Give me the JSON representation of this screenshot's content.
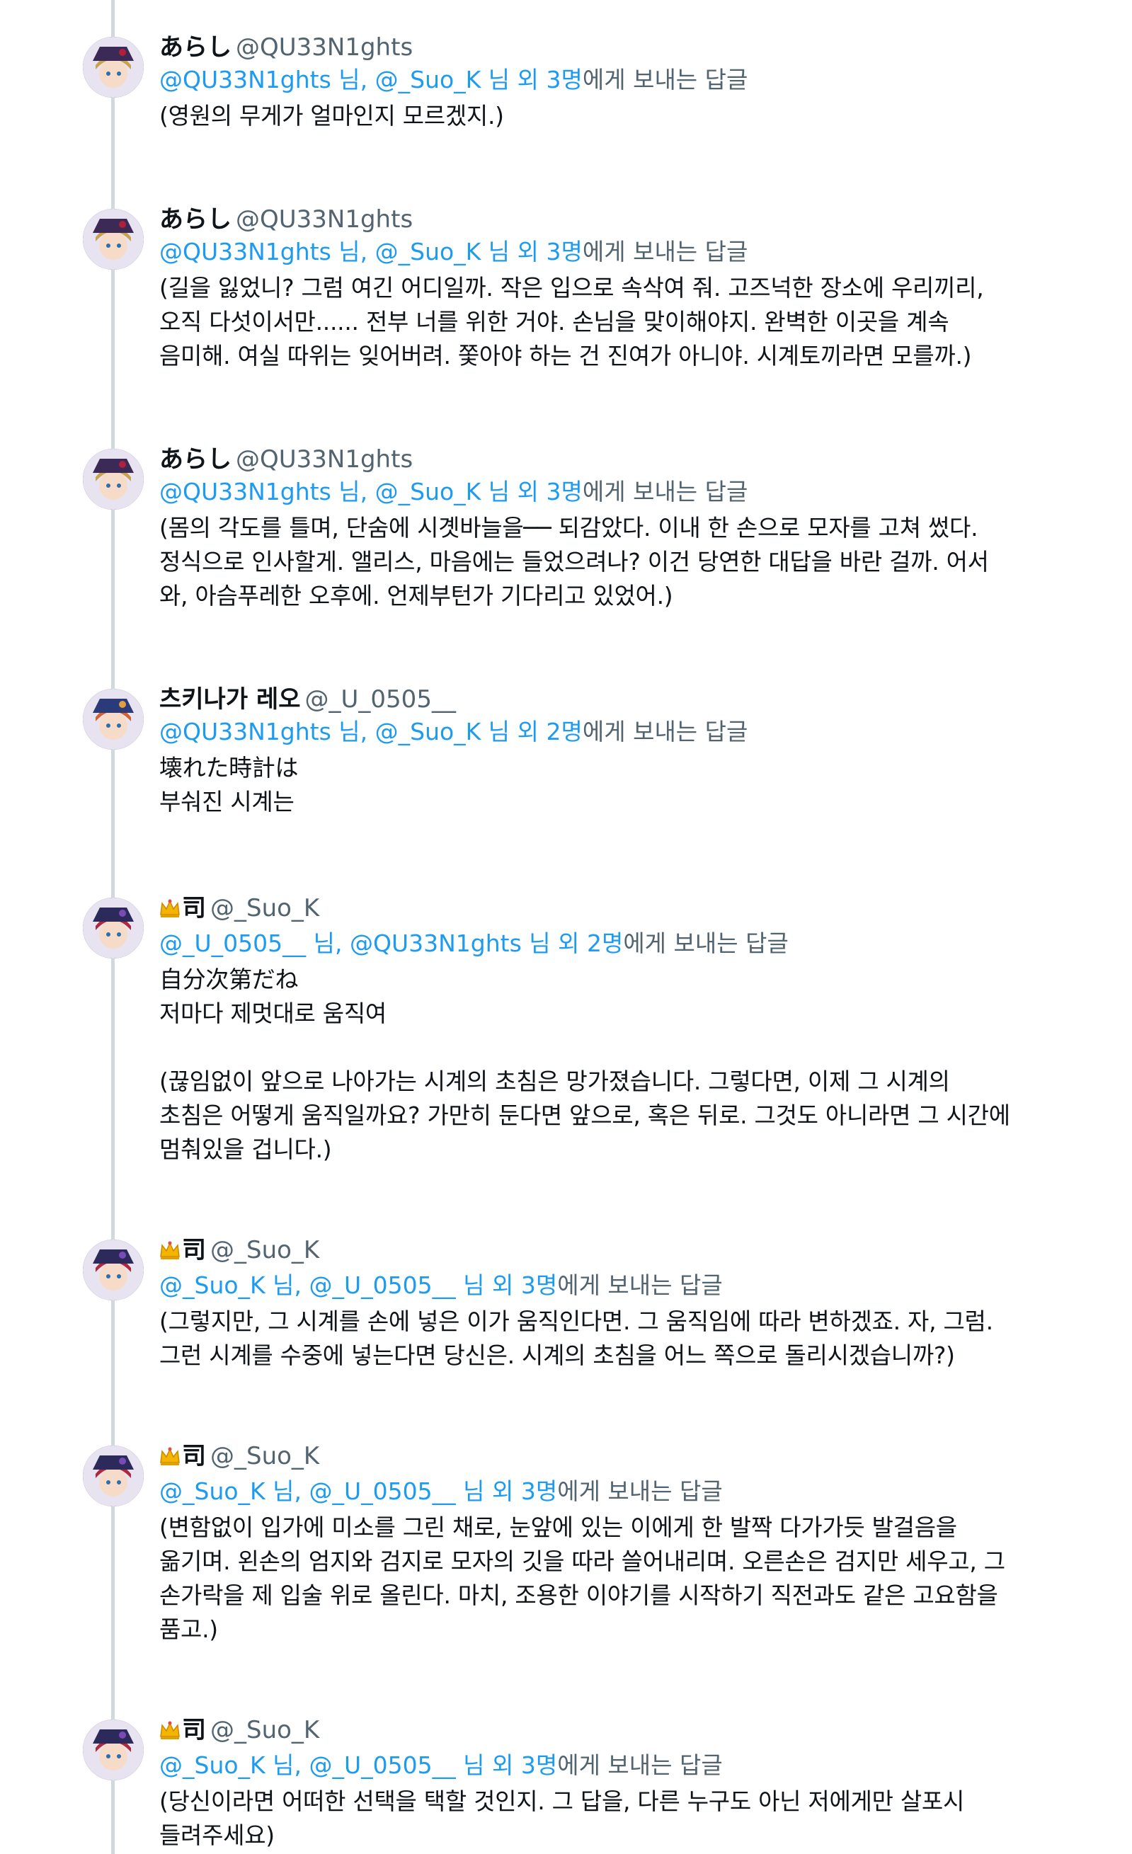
{
  "thread": {
    "tweets": [
      {
        "display_name": "あらし",
        "handle": "@QU33N1ghts",
        "has_crown": false,
        "avatar": {
          "hair": "#c9a24a",
          "hat": "#3a2a55",
          "accent": "#b0203a"
        },
        "reply_mentions": "@QU33N1ghts 님, @_Suo_K 님 외 3명",
        "reply_suffix": "에게 보내는 답글",
        "text": "(영원의 무게가 얼마인지 모르겠지.)"
      },
      {
        "display_name": "あらし",
        "handle": "@QU33N1ghts",
        "has_crown": false,
        "avatar": {
          "hair": "#c9a24a",
          "hat": "#3a2a55",
          "accent": "#b0203a"
        },
        "reply_mentions": "@QU33N1ghts 님, @_Suo_K 님 외 3명",
        "reply_suffix": "에게 보내는 답글",
        "text": "(길을 잃었니? 그럼 여긴 어디일까. 작은 입으로 속삭여 줘. 고즈넉한 장소에 우리끼리,\n오직 다섯이서만...... 전부 너를 위한 거야. 손님을 맞이해야지. 완벽한 이곳을 계속\n음미해. 여실 따위는 잊어버려. 쫓아야 하는 건 진여가 아니야. 시계토끼라면 모를까.)"
      },
      {
        "display_name": "あらし",
        "handle": "@QU33N1ghts",
        "has_crown": false,
        "avatar": {
          "hair": "#c9a24a",
          "hat": "#3a2a55",
          "accent": "#b0203a"
        },
        "reply_mentions": "@QU33N1ghts 님, @_Suo_K 님 외 3명",
        "reply_suffix": "에게 보내는 답글",
        "text": "(몸의 각도를 틀며, 단숨에 시곗바늘을── 되감았다. 이내 한 손으로 모자를 고쳐 썼다.\n정식으로 인사할게. 앨리스, 마음에는 들었으려나? 이건 당연한 대답을 바란 걸까. 어서\n와, 아슴푸레한 오후에. 언제부턴가 기다리고 있었어.)"
      },
      {
        "display_name": "츠키나가 레오",
        "handle": "@_U_0505__",
        "has_crown": false,
        "avatar": {
          "hair": "#d9602a",
          "hat": "#2b3a78",
          "accent": "#e0a040"
        },
        "reply_mentions": "@QU33N1ghts 님, @_Suo_K 님 외 2명",
        "reply_suffix": "에게 보내는 답글",
        "text": "壊れた時計は\n부숴진 시계는"
      },
      {
        "display_name": "司",
        "handle": "@_Suo_K",
        "has_crown": true,
        "avatar": {
          "hair": "#b0283a",
          "hat": "#2c2a5a",
          "accent": "#7a4bb5"
        },
        "reply_mentions": "@_U_0505__ 님, @QU33N1ghts 님 외 2명",
        "reply_suffix": "에게 보내는 답글",
        "text": "自分次第だね\n저마다 제멋대로 움직여\n\n(끊임없이 앞으로 나아가는 시계의 초침은 망가졌습니다. 그렇다면, 이제 그 시계의\n초침은 어떻게 움직일까요? 가만히 둔다면 앞으로, 혹은 뒤로. 그것도 아니라면 그 시간에\n멈춰있을 겁니다.)"
      },
      {
        "display_name": "司",
        "handle": "@_Suo_K",
        "has_crown": true,
        "avatar": {
          "hair": "#b0283a",
          "hat": "#2c2a5a",
          "accent": "#7a4bb5"
        },
        "reply_mentions": "@_Suo_K 님, @_U_0505__ 님 외 3명",
        "reply_suffix": "에게 보내는 답글",
        "text": "(그렇지만, 그 시계를 손에 넣은 이가 움직인다면. 그 움직임에 따라 변하겠죠. 자, 그럼.\n그런 시계를 수중에 넣는다면 당신은. 시계의 초침을 어느 쪽으로 돌리시겠습니까?)"
      },
      {
        "display_name": "司",
        "handle": "@_Suo_K",
        "has_crown": true,
        "avatar": {
          "hair": "#b0283a",
          "hat": "#2c2a5a",
          "accent": "#7a4bb5"
        },
        "reply_mentions": "@_Suo_K 님, @_U_0505__ 님 외 3명",
        "reply_suffix": "에게 보내는 답글",
        "text": "(변함없이 입가에 미소를 그린 채로, 눈앞에 있는 이에게 한 발짝 다가가듯 발걸음을\n옮기며. 왼손의 엄지와 검지로 모자의 깃을 따라 쓸어내리며. 오른손은 검지만 세우고, 그\n손가락을 제 입술 위로 올린다. 마치, 조용한 이야기를 시작하기 직전과도 같은 고요함을\n품고.)"
      },
      {
        "display_name": "司",
        "handle": "@_Suo_K",
        "has_crown": true,
        "avatar": {
          "hair": "#b0283a",
          "hat": "#2c2a5a",
          "accent": "#7a4bb5"
        },
        "reply_mentions": "@_Suo_K 님, @_U_0505__ 님 외 3명",
        "reply_suffix": "에게 보내는 답글",
        "text": "(당신이라면 어떠한 선택을 택할 것인지. 그 답을, 다른 누구도 아닌 저에게만 살포시\n들려주세요)"
      }
    ]
  }
}
